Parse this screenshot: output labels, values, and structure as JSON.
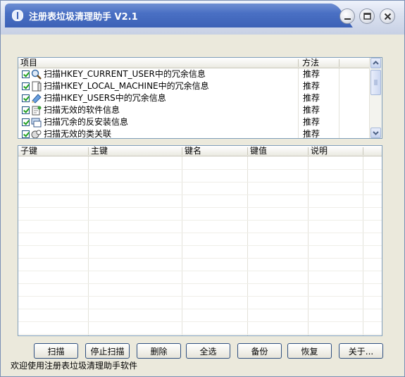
{
  "window": {
    "title": "注册表垃圾清理助手 V2.1"
  },
  "colors": {
    "title_bar": "#4a70c4",
    "window_bg": "#ebe9dc",
    "list_border": "#7f9db9",
    "checkbox": "#21a121"
  },
  "scan_list": {
    "columns": [
      "项目",
      "方法"
    ],
    "items": [
      {
        "label": "扫描HKEY_CURRENT_USER中的冗余信息",
        "method": "推荐",
        "checked": true,
        "icon": "magnifier-icon"
      },
      {
        "label": "扫描HKEY_LOCAL_MACHINE中的冗余信息",
        "method": "推荐",
        "checked": true,
        "icon": "document-icon"
      },
      {
        "label": "扫描HKEY_USERS中的冗余信息",
        "method": "推荐",
        "checked": true,
        "icon": "pencil-icon"
      },
      {
        "label": "扫描无效的软件信息",
        "method": "推荐",
        "checked": true,
        "icon": "software-icon"
      },
      {
        "label": "扫描冗余的反安装信息",
        "method": "推荐",
        "checked": true,
        "icon": "uninstall-icon"
      },
      {
        "label": "扫描无效的类关联",
        "method": "推荐",
        "checked": true,
        "icon": "class-icon"
      }
    ]
  },
  "results": {
    "columns": [
      "子键",
      "主键",
      "键名",
      "键值",
      "说明"
    ]
  },
  "buttons": {
    "scan": "扫描",
    "stop": "停止扫描",
    "delete": "删除",
    "select_all": "全选",
    "backup": "备份",
    "restore": "恢复",
    "about": "关于..."
  },
  "status": "欢迎使用注册表垃圾清理助手软件"
}
